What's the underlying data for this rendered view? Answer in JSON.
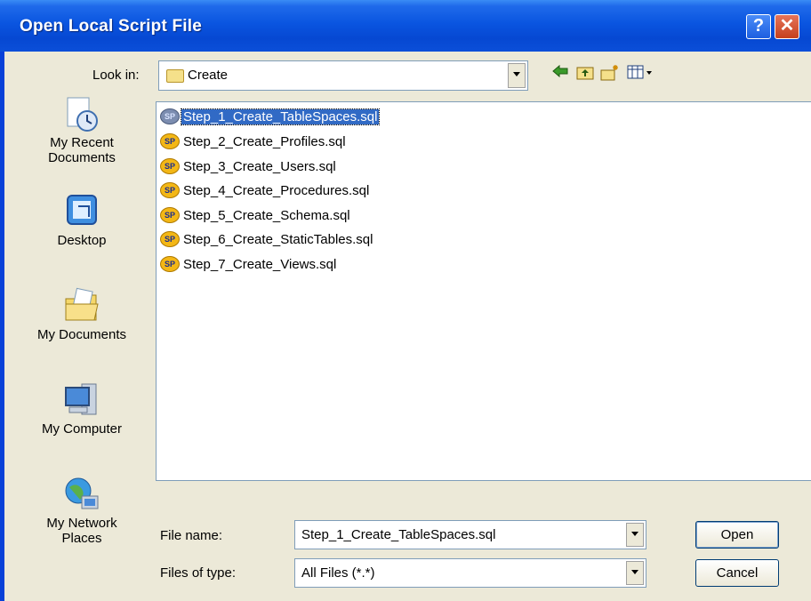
{
  "window": {
    "title": "Open Local Script File",
    "help_glyph": "?",
    "close_glyph": "✕"
  },
  "lookin": {
    "label": "Look in:",
    "value": "Create",
    "icon": "folder-icon"
  },
  "toolbar": {
    "back_icon": "back-arrow-icon",
    "up_icon": "up-folder-icon",
    "new_folder_icon": "new-folder-icon",
    "views_icon": "views-menu-icon"
  },
  "places": [
    {
      "label_line1": "My Recent",
      "label_line2": "Documents",
      "icon": "recent-documents-icon"
    },
    {
      "label_line1": "Desktop",
      "label_line2": "",
      "icon": "desktop-icon"
    },
    {
      "label_line1": "My Documents",
      "label_line2": "",
      "icon": "my-documents-icon"
    },
    {
      "label_line1": "My Computer",
      "label_line2": "",
      "icon": "my-computer-icon"
    },
    {
      "label_line1": "My Network",
      "label_line2": "Places",
      "icon": "network-places-icon"
    }
  ],
  "files": [
    {
      "name": "Step_1_Create_TableSpaces.sql",
      "icon_text": "SP",
      "selected": true
    },
    {
      "name": "Step_2_Create_Profiles.sql",
      "icon_text": "SP",
      "selected": false
    },
    {
      "name": "Step_3_Create_Users.sql",
      "icon_text": "SP",
      "selected": false
    },
    {
      "name": "Step_4_Create_Procedures.sql",
      "icon_text": "SP",
      "selected": false
    },
    {
      "name": "Step_5_Create_Schema.sql",
      "icon_text": "SP",
      "selected": false
    },
    {
      "name": "Step_6_Create_StaticTables.sql",
      "icon_text": "SP",
      "selected": false
    },
    {
      "name": "Step_7_Create_Views.sql",
      "icon_text": "SP",
      "selected": false
    }
  ],
  "filename": {
    "label": "File name:",
    "value": "Step_1_Create_TableSpaces.sql"
  },
  "filetype": {
    "label": "Files of type:",
    "value": "All Files (*.*)"
  },
  "buttons": {
    "open": "Open",
    "cancel": "Cancel"
  },
  "colors": {
    "title_bar": "#0a55e0",
    "selection": "#316ac5",
    "dialog_bg": "#ece9d8"
  }
}
